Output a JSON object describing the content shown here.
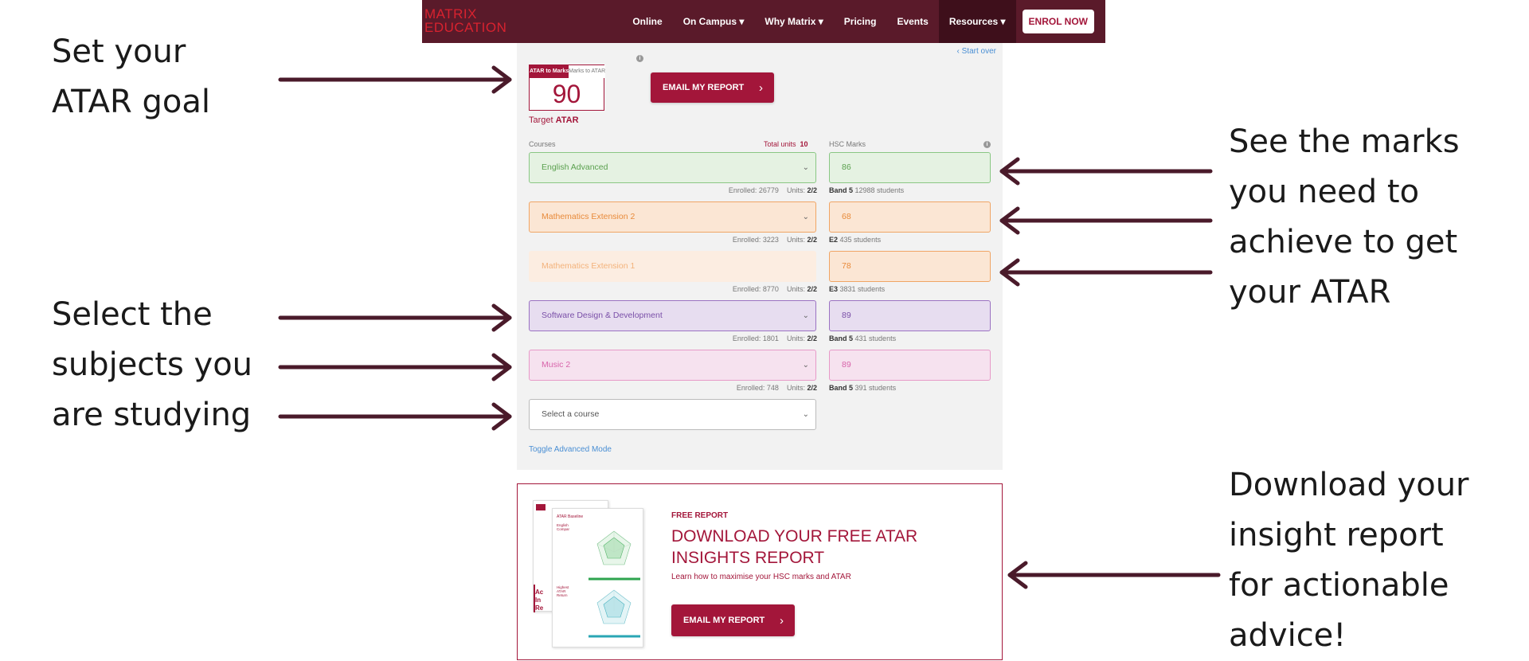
{
  "navbar": {
    "logo_line1": "MATRIX",
    "logo_line2": "EDUCATION",
    "items": [
      "Online",
      "On Campus ▾",
      "Why Matrix ▾",
      "Pricing",
      "Events",
      "Resources ▾"
    ],
    "enrol_label": "ENROL NOW",
    "colors": {
      "bar": "#5a1a2a",
      "active": "#3e0f1b",
      "brand": "#a3163a"
    }
  },
  "calculator": {
    "start_over": "‹  Start over",
    "tab_active": "ATAR to Marks",
    "tab_inactive": "Marks to ATAR",
    "target_value": "90",
    "target_label_prefix": "Target",
    "target_label_strong": "ATAR",
    "email_label": "EMAIL MY REPORT",
    "courses_header": "Courses",
    "total_units_label": "Total units",
    "total_units_value": "10",
    "marks_header": "HSC Marks",
    "rows": [
      {
        "course": "English Advanced",
        "mark": "86",
        "enrolled": "Enrolled: 26779",
        "units": "2/2",
        "band": "Band 5",
        "students": "12988 students",
        "color": "green"
      },
      {
        "course": "Mathematics Extension 2",
        "mark": "68",
        "enrolled": "Enrolled: 3223",
        "units": "2/2",
        "band": "E2",
        "students": "435 students",
        "color": "orange"
      },
      {
        "course": "Mathematics Extension 1",
        "mark": "78",
        "enrolled": "Enrolled: 8770",
        "units": "2/2",
        "band": "E3",
        "students": "3831 students",
        "color": "orange-light"
      },
      {
        "course": "Software Design & Development",
        "mark": "89",
        "enrolled": "Enrolled: 1801",
        "units": "2/2",
        "band": "Band 5",
        "students": "431 students",
        "color": "purple"
      },
      {
        "course": "Music 2",
        "mark": "89",
        "enrolled": "Enrolled: 748",
        "units": "2/2",
        "band": "Band 5",
        "students": "391 students",
        "color": "pink"
      }
    ],
    "units_prefix": "Units:",
    "select_placeholder": "Select a course",
    "toggle_advanced": "Toggle Advanced Mode"
  },
  "promo": {
    "free_label": "FREE REPORT",
    "title_line1": "DOWNLOAD YOUR FREE ATAR",
    "title_line2": "INSIGHTS REPORT",
    "subtitle": "Learn how to maximise your HSC marks and ATAR",
    "email_label": "EMAIL MY REPORT",
    "doc_title": "ATAR Baseline",
    "doc_course": "English Compar",
    "doc_section": "Highest ATAR Return",
    "doc_side": "Ac In Re"
  },
  "callouts": {
    "atar_goal": [
      "Set your",
      "ATAR goal"
    ],
    "marks_needed": [
      "See the marks",
      "you need to",
      "achieve to get",
      "your ATAR"
    ],
    "select_subjects": [
      "Select the",
      "subjects you",
      "are studying"
    ],
    "download_report": [
      "Download your",
      "insight report",
      "for actionable",
      "advice!"
    ]
  }
}
